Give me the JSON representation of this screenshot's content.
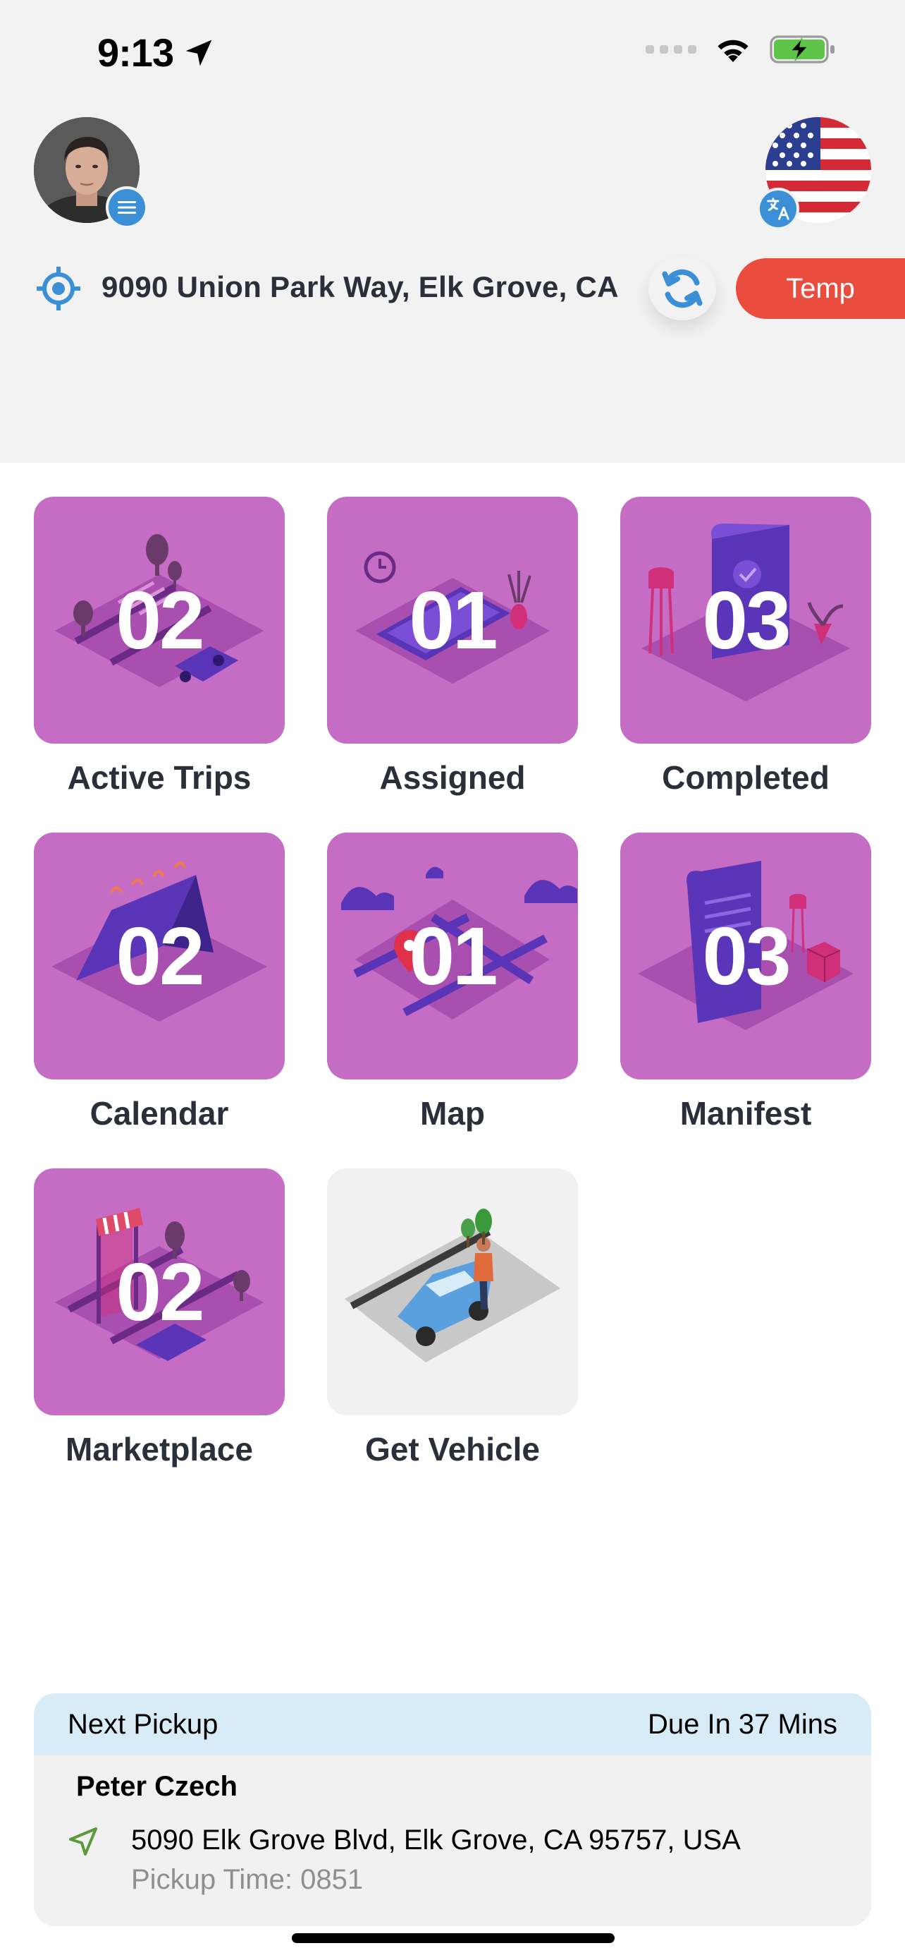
{
  "status_bar": {
    "time": "9:13"
  },
  "location": {
    "address": "9090 Union Park Way, Elk Grove, CA"
  },
  "temp_button": {
    "label": "Temp"
  },
  "colors": {
    "tile": "#c56cc4",
    "accent_red": "#ea4d3d",
    "accent_blue": "#3a8fd6",
    "pickup_header": "#d8ecf8"
  },
  "tiles": [
    {
      "label": "Active Trips",
      "count": "02",
      "icon": "trips-road-icon"
    },
    {
      "label": "Assigned",
      "count": "01",
      "icon": "assigned-phone-icon"
    },
    {
      "label": "Completed",
      "count": "03",
      "icon": "completed-document-icon"
    },
    {
      "label": "Calendar",
      "count": "02",
      "icon": "calendar-icon"
    },
    {
      "label": "Map",
      "count": "01",
      "icon": "map-pin-icon"
    },
    {
      "label": "Manifest",
      "count": "03",
      "icon": "manifest-scroll-icon"
    },
    {
      "label": "Marketplace",
      "count": "02",
      "icon": "marketplace-store-icon"
    },
    {
      "label": "Get Vehicle",
      "count": "",
      "icon": "vehicle-car-icon"
    }
  ],
  "next_pickup": {
    "header_left": "Next Pickup",
    "header_right": "Due In 37 Mins",
    "name": "Peter Czech",
    "address": "5090 Elk Grove Blvd, Elk Grove, CA 95757, USA",
    "time": "Pickup Time: 0851"
  }
}
